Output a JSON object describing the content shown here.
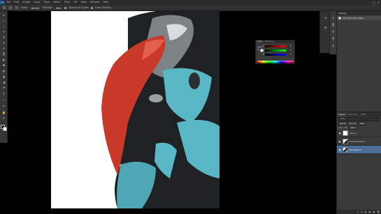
{
  "app": {
    "logo": "Ps"
  },
  "menu": [
    "File",
    "Edit",
    "Image",
    "Layer",
    "Type",
    "Select",
    "Filter",
    "3D",
    "View",
    "Window",
    "Help"
  ],
  "window_controls": [
    "–",
    "□",
    "×"
  ],
  "options_bar": {
    "mode_label": "Mode:",
    "mode_value": "Normal",
    "strength_label": "Strength:",
    "strength_value": "50%",
    "sample_all_layers": "Sample All Layers",
    "finger_painting": "Finger Painting"
  },
  "tools": [
    "▸",
    "⬚",
    "◌",
    "✦",
    "⌗",
    "✎",
    "✐",
    "⎘",
    "◐",
    "✚",
    "▤",
    "▲",
    "◢",
    "◔",
    "T",
    "↖",
    "▭",
    "✋",
    "⚲"
  ],
  "color_panel": {
    "tabs": [
      "Color",
      "Swatches"
    ],
    "channels": [
      {
        "label": "R",
        "value": "0"
      },
      {
        "label": "G",
        "value": "0"
      },
      {
        "label": "B",
        "value": "0"
      }
    ]
  },
  "history_panel": {
    "tab": "History",
    "state": "Last Document State"
  },
  "layers_panel": {
    "tabs": [
      "Layers",
      "Channels",
      "Paths"
    ],
    "filter": "Kind",
    "blend_mode": "Normal",
    "opacity_label": "Opacity:",
    "opacity_value": "100%",
    "lock_label": "Lock:",
    "fill_label": "Fill:",
    "fill_value": "100%",
    "layers": [
      {
        "name": "Layer 1"
      },
      {
        "name": "Hue/Saturation 1"
      },
      {
        "name": "Background",
        "selected": true
      }
    ],
    "footer_icons": [
      "∞",
      "fx",
      "◐",
      "▣",
      "▦",
      "🗑"
    ]
  },
  "artwork": {
    "colors": {
      "red": "#c8392a",
      "teal": "#5ab8c6",
      "dark": "#1e2224",
      "grey": "#7c8286"
    }
  }
}
